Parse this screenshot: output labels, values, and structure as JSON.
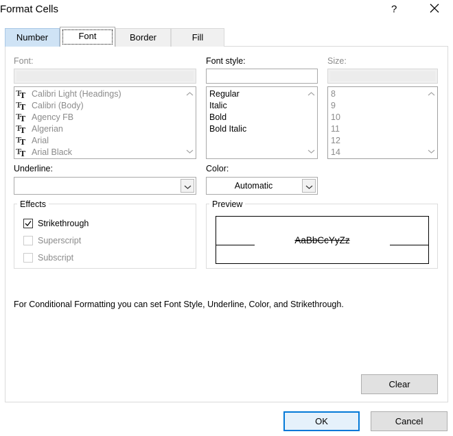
{
  "window": {
    "title": "Format Cells",
    "help_label": "?"
  },
  "tabs": [
    {
      "label": "Number"
    },
    {
      "label": "Font"
    },
    {
      "label": "Border"
    },
    {
      "label": "Fill"
    }
  ],
  "font": {
    "label": "Font:",
    "value": "",
    "items": [
      "Calibri Light (Headings)",
      "Calibri (Body)",
      "Agency FB",
      "Algerian",
      "Arial",
      "Arial Black"
    ]
  },
  "font_style": {
    "label": "Font style:",
    "value": "",
    "items": [
      "Regular",
      "Italic",
      "Bold",
      "Bold Italic"
    ]
  },
  "size": {
    "label": "Size:",
    "value": "",
    "items": [
      "8",
      "9",
      "10",
      "11",
      "12",
      "14"
    ]
  },
  "underline": {
    "label": "Underline:",
    "value": ""
  },
  "color": {
    "label": "Color:",
    "value": "Automatic"
  },
  "effects": {
    "title": "Effects",
    "strikethrough": {
      "label": "Strikethrough",
      "checked": true
    },
    "superscript": {
      "label": "Superscript",
      "checked": false
    },
    "subscript": {
      "label": "Subscript",
      "checked": false
    }
  },
  "preview": {
    "title": "Preview",
    "sample": "AaBbCcYyZz"
  },
  "info_text": "For Conditional Formatting you can set Font Style, Underline, Color, and Strikethrough.",
  "buttons": {
    "clear": "Clear",
    "ok": "OK",
    "cancel": "Cancel"
  },
  "colors": {
    "accent": "#0078d7",
    "disabled_text": "#8b8b8b",
    "selected_tab": "#cfe3f5"
  }
}
